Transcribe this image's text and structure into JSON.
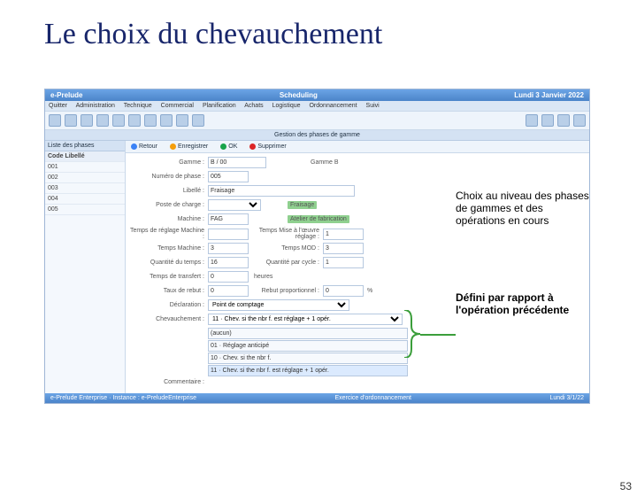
{
  "slide": {
    "title": "Le choix du chevauchement",
    "number": "53"
  },
  "app": {
    "titlebar": {
      "left": "e-Prelude",
      "center": "Scheduling",
      "right": "Lundi 3 Janvier 2022"
    },
    "menubar": [
      "Quitter",
      "Administration",
      "Technique",
      "Commercial",
      "Planification",
      "Achats",
      "Logistique",
      "Ordonnancement",
      "Suivi"
    ],
    "subbar": "Gestion des phases de gamme",
    "btnrow": {
      "retour": "Retour",
      "enreg": "Enregistrer",
      "ok": "OK",
      "suppr": "Supprimer"
    },
    "sidepane": {
      "header": "Liste des phases",
      "cols": "Code   Libellé",
      "rows": [
        "001",
        "002",
        "003",
        "004",
        "005"
      ]
    },
    "form": {
      "gamme_lbl": "Gamme :",
      "gamme_val": "B / 00",
      "gamme_desc": "Gamme B",
      "phase_lbl": "Numéro de phase :",
      "phase_val": "005",
      "libelle_lbl": "Libellé :",
      "libelle_val": "Fraisage",
      "poste_lbl": "Poste de charge :",
      "poste_val": "",
      "poste_desc": "Fraisage",
      "machine_lbl": "Machine :",
      "machine_val": "FAG",
      "machine_desc": "Atelier de fabrication",
      "tr_machine_lbl": "Temps de réglage Machine :",
      "tr_machine_val": "",
      "tr_mo_lbl": "Temps Mise à l'œuvre réglage :",
      "tr_mo_val": "1",
      "tm_lbl": "Temps Machine :",
      "tm_val": "3",
      "tmod_lbl": "Temps MOD :",
      "tmod_val": "3",
      "qte_lbl": "Quantité du temps :",
      "qte_val": "16",
      "qtecycle_lbl": "Quantité par cycle :",
      "qtecycle_val": "1",
      "tt_lbl": "Temps de transfert :",
      "tt_val": "0",
      "tt_unit": "heures",
      "rebut_lbl": "Taux de rebut :",
      "rebut_val": "0",
      "rebutp_lbl": "Rebut proportionnel :",
      "rebutp_val": "0",
      "rebutp_unit": "%",
      "decl_lbl": "Déclaration :",
      "decl_val": "Point de comptage",
      "chev_lbl": "Chevauchement :",
      "chev_val": "11 · Chev. si the nbr f. est réglage + 1 opér.",
      "chev_opts": [
        "(aucun)",
        "01 · Réglage anticipé",
        "10 · Chev. si the nbr f.",
        "11 · Chev. si the nbr f. est réglage + 1 opér."
      ],
      "comment_lbl": "Commentaire :"
    },
    "statusbar": {
      "left": "e-Prelude Enterprise · Instance : e-PreludeEnterprise",
      "center": "Exercice d'ordonnancement",
      "right": "Lundi 3/1/22"
    }
  },
  "callouts": {
    "c1": "Choix au niveau des phases de gammes et des opérations en cours",
    "c2": "Défini par rapport à l'opération précédente"
  }
}
